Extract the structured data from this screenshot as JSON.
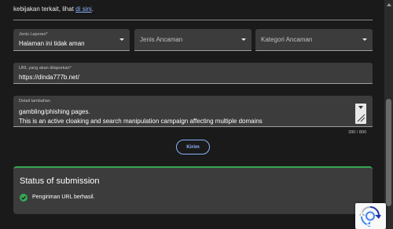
{
  "intro": {
    "prefix": "kebijakan terkait, lihat ",
    "link": "di sini",
    "suffix": "."
  },
  "form": {
    "jenis_laporan": {
      "label": "Jenis Laporan*",
      "value": "Halaman ini tidak aman"
    },
    "jenis_ancaman": {
      "placeholder": "Jenis Ancaman"
    },
    "kategori_ancaman": {
      "placeholder": "Kategori Ancaman"
    },
    "url": {
      "label": "URL yang akan dilaporkan*",
      "value": "https://dinda777b.net/"
    },
    "detail": {
      "label": "Detail tambahan",
      "line1": "gambling/phishing pages.",
      "line2": "This is an active cloaking and search manipulation campaign affecting multiple domains"
    },
    "char_counter": "390 / 800",
    "submit_label": "Kirim"
  },
  "status": {
    "title": "Status of submission",
    "message": "Pengiriman URL berhasil.",
    "accent_color": "#34a853"
  },
  "colors": {
    "link": "#8ab4f8",
    "field_bg": "#3c3c3c",
    "page_bg": "#1a1a1a"
  },
  "icons": {
    "dropdown": "chevron-down-icon",
    "success": "check-circle-icon",
    "captcha": "recaptcha-icon"
  }
}
